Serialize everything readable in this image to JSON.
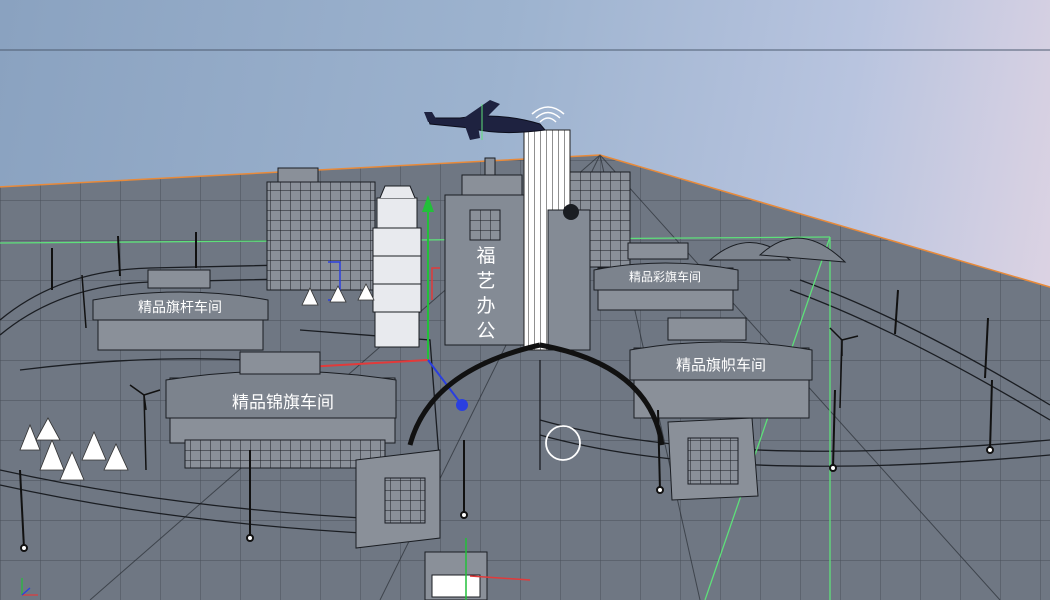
{
  "scene": {
    "office_tower_sign": "福艺办公",
    "workshop_signs": {
      "left_upper": "精品旗杆车间",
      "left_lower": "精品锦旗车间",
      "right_upper": "精品彩旗车间",
      "right_lower": "精品旗帜车间"
    }
  },
  "colors": {
    "sky_top": "#8aa2c0",
    "sky_right": "#e4d6e4",
    "ground": "#6d7580",
    "wire": "#1a1d22",
    "white_wire": "#f2f4f7",
    "axis_x": "#e23a3a",
    "axis_y": "#22c03a",
    "axis_z": "#2a3fe0",
    "selection_box": "#5ee07a"
  },
  "icons": {
    "airplane": "airplane-icon",
    "wifi": "wifi-icon",
    "gizmo": "transform-gizmo-icon",
    "orbit_circle": "orbit-cursor-icon"
  }
}
